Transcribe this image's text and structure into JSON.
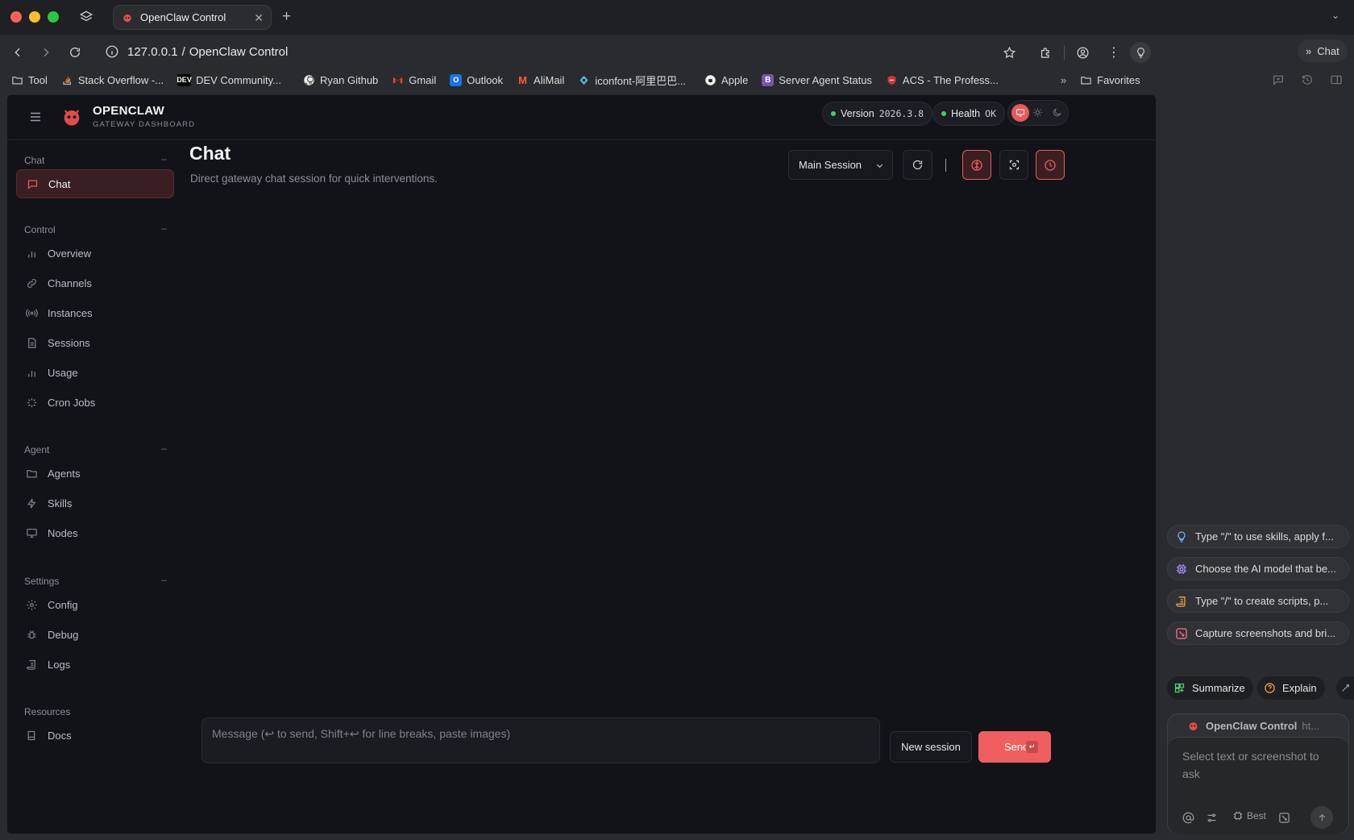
{
  "browser": {
    "tab_title": "OpenClaw Control",
    "url_host": "127.0.0.1",
    "url_separator": "/",
    "url_title": "OpenClaw Control",
    "side_chat_label": "Chat",
    "bookmarks": [
      {
        "label": "Tool",
        "icon": "folder-icon"
      },
      {
        "label": "Stack Overflow -...",
        "icon": "stackoverflow-icon"
      },
      {
        "label": "DEV Community...",
        "icon": "dev-icon"
      },
      {
        "label": "Ryan Github",
        "icon": "github-icon"
      },
      {
        "label": "Gmail",
        "icon": "gmail-icon"
      },
      {
        "label": "Outlook",
        "icon": "outlook-icon"
      },
      {
        "label": "AliMail",
        "icon": "alimail-icon"
      },
      {
        "label": "iconfont-阿里巴巴...",
        "icon": "iconfont-icon"
      },
      {
        "label": "Apple",
        "icon": "apple-icon"
      },
      {
        "label": "Server Agent Status",
        "icon": "bootstrap-icon"
      },
      {
        "label": "ACS - The Profess...",
        "icon": "acs-icon"
      }
    ],
    "favorites_label": "Favorites"
  },
  "app": {
    "brand_name": "OPENCLAW",
    "brand_sub": "GATEWAY DASHBOARD",
    "version_label": "Version",
    "version_value": "2026.3.8",
    "health_label": "Health",
    "health_value": "OK",
    "colors": {
      "accent": "#e85a5a",
      "status_ok": "#3ecf6e",
      "background": "#121318"
    }
  },
  "sidebar": {
    "sections": [
      {
        "title": "Chat",
        "items": [
          {
            "label": "Chat",
            "icon": "chat-bubble-icon",
            "active": true
          }
        ]
      },
      {
        "title": "Control",
        "items": [
          {
            "label": "Overview",
            "icon": "bar-chart-icon"
          },
          {
            "label": "Channels",
            "icon": "link-icon"
          },
          {
            "label": "Instances",
            "icon": "broadcast-icon"
          },
          {
            "label": "Sessions",
            "icon": "document-icon"
          },
          {
            "label": "Usage",
            "icon": "bar-chart-icon"
          },
          {
            "label": "Cron Jobs",
            "icon": "loader-icon"
          }
        ]
      },
      {
        "title": "Agent",
        "items": [
          {
            "label": "Agents",
            "icon": "folder-icon"
          },
          {
            "label": "Skills",
            "icon": "bolt-icon"
          },
          {
            "label": "Nodes",
            "icon": "monitor-icon"
          }
        ]
      },
      {
        "title": "Settings",
        "items": [
          {
            "label": "Config",
            "icon": "gear-icon"
          },
          {
            "label": "Debug",
            "icon": "bug-icon"
          },
          {
            "label": "Logs",
            "icon": "scroll-icon"
          }
        ]
      },
      {
        "title": "Resources",
        "items": [
          {
            "label": "Docs",
            "icon": "book-icon"
          }
        ]
      }
    ],
    "collapse_glyph": "–"
  },
  "main": {
    "title": "Chat",
    "subtitle": "Direct gateway chat session for quick interventions.",
    "session_select": "Main Session",
    "message_placeholder": "Message (↩ to send, Shift+↩ for line breaks, paste images)",
    "new_session_label": "New session",
    "send_label": "Send",
    "send_kbd": "↵"
  },
  "assistant_panel": {
    "suggestions": [
      {
        "text": "Type \"/\" to use skills, apply f...",
        "icon": "lightbulb-icon",
        "color": "#6fa8ff"
      },
      {
        "text": "Choose the AI model that be...",
        "icon": "chip-icon",
        "color": "#a68cff"
      },
      {
        "text": "Type \"/\" to create scripts, p...",
        "icon": "script-icon",
        "color": "#f0a446"
      },
      {
        "text": "Capture screenshots and bri...",
        "icon": "screenshot-icon",
        "color": "#ff6b8a"
      }
    ],
    "chips": [
      {
        "text": "Summarize",
        "icon": "grid-icon",
        "color": "#4fd07a"
      },
      {
        "text": "Explain",
        "icon": "question-icon",
        "color": "#f0a446"
      }
    ],
    "context_title": "OpenClaw Control",
    "context_url": "ht...",
    "input_placeholder": "Select text or screenshot to ask",
    "model_label": "Best"
  }
}
